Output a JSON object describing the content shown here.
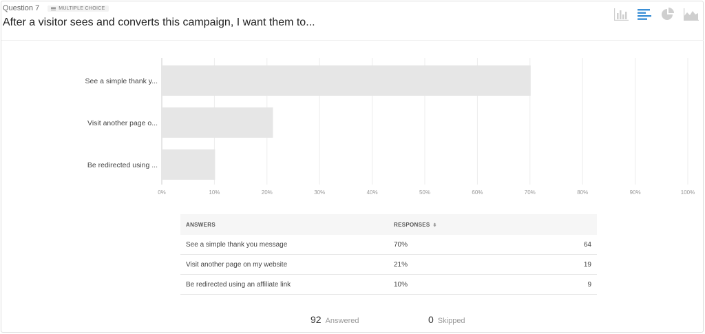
{
  "question": {
    "number_label": "Question 7",
    "type_label": "MULTIPLE CHOICE",
    "title": "After a visitor sees and converts this campaign, I want them to..."
  },
  "chart_type_buttons": [
    {
      "name": "vertical-bar-chart-icon",
      "active": false
    },
    {
      "name": "horizontal-bar-chart-icon",
      "active": true
    },
    {
      "name": "pie-chart-icon",
      "active": false
    },
    {
      "name": "area-chart-icon",
      "active": false
    }
  ],
  "colors": {
    "bar": "#e6e6e6",
    "active_icon": "#3b8fd6",
    "inactive_icon": "#cfcfcf",
    "grid": "#ececec"
  },
  "chart_data": {
    "type": "bar",
    "orientation": "horizontal",
    "categories": [
      "See a simple thank y...",
      "Visit another page o...",
      "Be redirected using ..."
    ],
    "values": [
      70,
      21,
      10
    ],
    "xlim": [
      0,
      100
    ],
    "x_ticks": [
      "0%",
      "10%",
      "20%",
      "30%",
      "40%",
      "50%",
      "60%",
      "70%",
      "80%",
      "90%",
      "100%"
    ],
    "grid": true,
    "title": "",
    "xlabel": "",
    "ylabel": ""
  },
  "table": {
    "headers": {
      "answers": "ANSWERS",
      "responses": "RESPONSES"
    },
    "rows": [
      {
        "answer": "See a simple thank you message",
        "percent": "70%",
        "count": "64"
      },
      {
        "answer": "Visit another page on my website",
        "percent": "21%",
        "count": "19"
      },
      {
        "answer": "Be redirected using an affiliate link",
        "percent": "10%",
        "count": "9"
      }
    ]
  },
  "stats": {
    "answered_count": "92",
    "answered_label": "Answered",
    "skipped_count": "0",
    "skipped_label": "Skipped"
  }
}
